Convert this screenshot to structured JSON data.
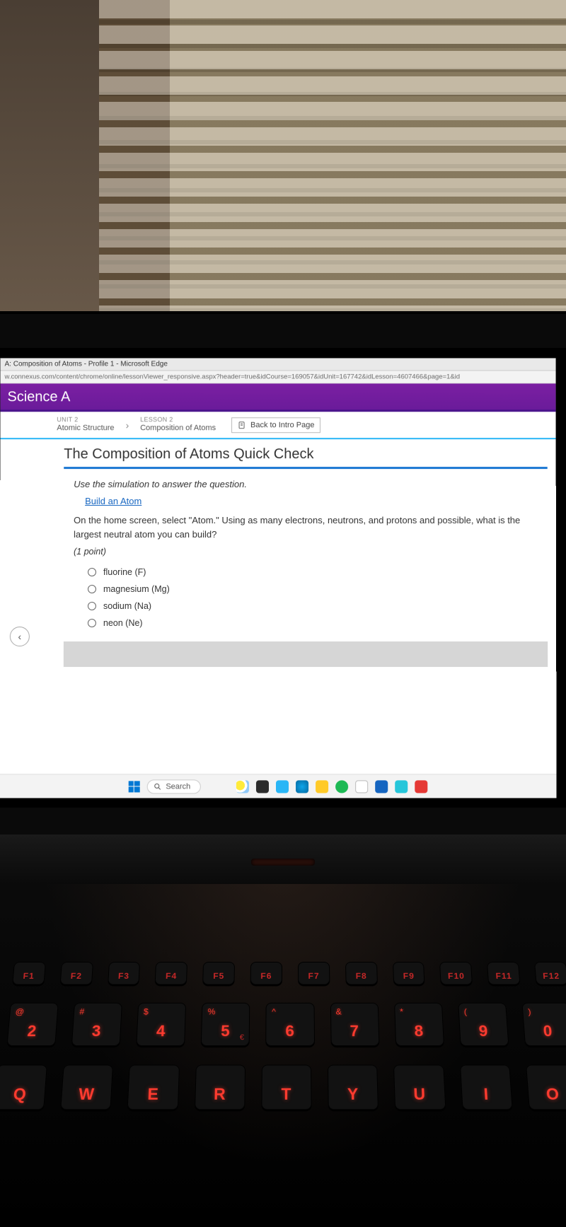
{
  "browser": {
    "title": "A: Composition of Atoms - Profile 1 - Microsoft Edge",
    "url": "w.connexus.com/content/chrome/online/lessonViewer_responsive.aspx?header=true&idCourse=169057&idUnit=167742&idLesson=4607466&page=1&id"
  },
  "course_header": "Science A",
  "breadcrumb": {
    "unit_label": "UNIT 2",
    "unit_name": "Atomic Structure",
    "lesson_label": "LESSON 2",
    "lesson_name": "Composition of Atoms",
    "back_button": "Back to Intro Page"
  },
  "quiz": {
    "title": "The Composition of Atoms Quick Check",
    "instruction": "Use the simulation to answer the question.",
    "sim_link": "Build an Atom",
    "question": "On the home screen, select \"Atom.\" Using as many electrons, neutrons, and protons and possible, what is the largest neutral atom you can build?",
    "points": "(1 point)",
    "options": [
      "fluorine (F)",
      "magnesium (Mg)",
      "sodium (Na)",
      "neon (Ne)"
    ]
  },
  "taskbar": {
    "search_placeholder": "Search"
  },
  "keyboard": {
    "fn": [
      "F1",
      "F2",
      "F3",
      "F4",
      "F5",
      "F6",
      "F7",
      "F8",
      "F9",
      "F10",
      "F11",
      "F12"
    ],
    "num": [
      {
        "alt": "@",
        "main": "2"
      },
      {
        "alt": "#",
        "main": "3"
      },
      {
        "alt": "$",
        "main": "4"
      },
      {
        "alt": "%",
        "main": "5",
        "alt2": "€"
      },
      {
        "alt": "^",
        "main": "6"
      },
      {
        "alt": "&",
        "main": "7"
      },
      {
        "alt": "*",
        "main": "8"
      },
      {
        "alt": "(",
        "main": "9"
      },
      {
        "alt": ")",
        "main": "0"
      }
    ],
    "letters": [
      "Q",
      "W",
      "E",
      "R",
      "T",
      "Y",
      "U",
      "I",
      "O"
    ]
  }
}
